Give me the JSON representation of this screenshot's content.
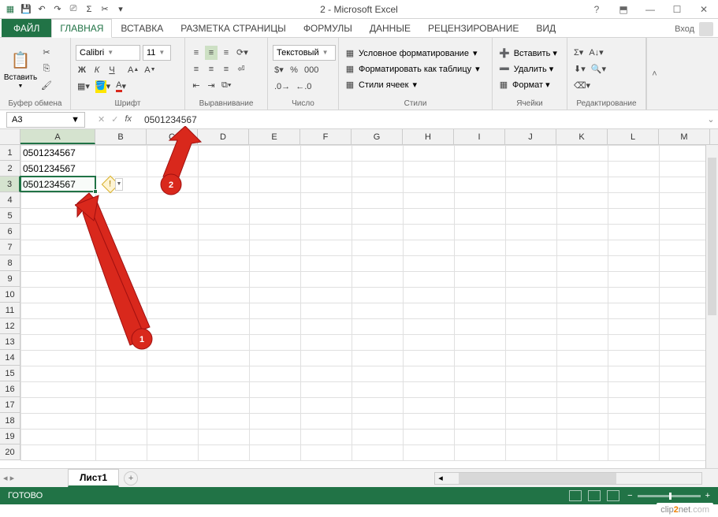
{
  "window": {
    "title": "2 - Microsoft Excel"
  },
  "tabs": {
    "file": "ФАЙЛ",
    "items": [
      "ГЛАВНАЯ",
      "ВСТАВКА",
      "РАЗМЕТКА СТРАНИЦЫ",
      "ФОРМУЛЫ",
      "ДАННЫЕ",
      "РЕЦЕНЗИРОВАНИЕ",
      "ВИД"
    ],
    "active": 0,
    "login": "Вход"
  },
  "ribbon": {
    "clipboard": {
      "title": "Буфер обмена",
      "paste": "Вставить"
    },
    "font": {
      "title": "Шрифт",
      "name": "Calibri",
      "size": "11",
      "bold": "Ж",
      "italic": "К",
      "underline": "Ч"
    },
    "alignment": {
      "title": "Выравнивание"
    },
    "number": {
      "title": "Число",
      "format": "Текстовый"
    },
    "styles": {
      "title": "Стили",
      "conditional": "Условное форматирование",
      "table": "Форматировать как таблицу",
      "cell": "Стили ячеек"
    },
    "cells": {
      "title": "Ячейки",
      "insert": "Вставить",
      "delete": "Удалить",
      "format": "Формат"
    },
    "editing": {
      "title": "Редактирование"
    }
  },
  "namebox": "A3",
  "formula": "0501234567",
  "columns": [
    "A",
    "B",
    "C",
    "D",
    "E",
    "F",
    "G",
    "H",
    "I",
    "J",
    "K",
    "L",
    "M"
  ],
  "rows_count": 20,
  "cells": {
    "A1": "0501234567",
    "A2": "0501234567",
    "A3": "0501234567"
  },
  "selection": {
    "col": 0,
    "row": 2
  },
  "sheets": {
    "active": "Лист1"
  },
  "status": {
    "ready": "ГОТОВО",
    "zoom": ""
  },
  "annotations": {
    "a1": "1",
    "a2": "2"
  },
  "watermark": {
    "pre": "clip",
    "mid": "2",
    "post": "net",
    "suf": ".com"
  }
}
